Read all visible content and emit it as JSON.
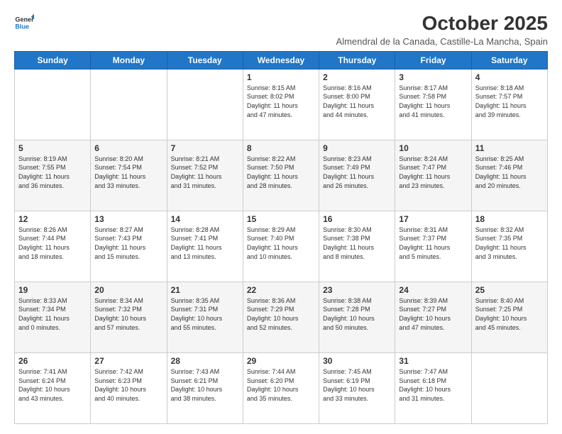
{
  "header": {
    "logo_line1": "General",
    "logo_line2": "Blue",
    "month": "October 2025",
    "location": "Almendral de la Canada, Castille-La Mancha, Spain"
  },
  "weekdays": [
    "Sunday",
    "Monday",
    "Tuesday",
    "Wednesday",
    "Thursday",
    "Friday",
    "Saturday"
  ],
  "weeks": [
    [
      {
        "day": "",
        "info": ""
      },
      {
        "day": "",
        "info": ""
      },
      {
        "day": "",
        "info": ""
      },
      {
        "day": "1",
        "info": "Sunrise: 8:15 AM\nSunset: 8:02 PM\nDaylight: 11 hours\nand 47 minutes."
      },
      {
        "day": "2",
        "info": "Sunrise: 8:16 AM\nSunset: 8:00 PM\nDaylight: 11 hours\nand 44 minutes."
      },
      {
        "day": "3",
        "info": "Sunrise: 8:17 AM\nSunset: 7:58 PM\nDaylight: 11 hours\nand 41 minutes."
      },
      {
        "day": "4",
        "info": "Sunrise: 8:18 AM\nSunset: 7:57 PM\nDaylight: 11 hours\nand 39 minutes."
      }
    ],
    [
      {
        "day": "5",
        "info": "Sunrise: 8:19 AM\nSunset: 7:55 PM\nDaylight: 11 hours\nand 36 minutes."
      },
      {
        "day": "6",
        "info": "Sunrise: 8:20 AM\nSunset: 7:54 PM\nDaylight: 11 hours\nand 33 minutes."
      },
      {
        "day": "7",
        "info": "Sunrise: 8:21 AM\nSunset: 7:52 PM\nDaylight: 11 hours\nand 31 minutes."
      },
      {
        "day": "8",
        "info": "Sunrise: 8:22 AM\nSunset: 7:50 PM\nDaylight: 11 hours\nand 28 minutes."
      },
      {
        "day": "9",
        "info": "Sunrise: 8:23 AM\nSunset: 7:49 PM\nDaylight: 11 hours\nand 26 minutes."
      },
      {
        "day": "10",
        "info": "Sunrise: 8:24 AM\nSunset: 7:47 PM\nDaylight: 11 hours\nand 23 minutes."
      },
      {
        "day": "11",
        "info": "Sunrise: 8:25 AM\nSunset: 7:46 PM\nDaylight: 11 hours\nand 20 minutes."
      }
    ],
    [
      {
        "day": "12",
        "info": "Sunrise: 8:26 AM\nSunset: 7:44 PM\nDaylight: 11 hours\nand 18 minutes."
      },
      {
        "day": "13",
        "info": "Sunrise: 8:27 AM\nSunset: 7:43 PM\nDaylight: 11 hours\nand 15 minutes."
      },
      {
        "day": "14",
        "info": "Sunrise: 8:28 AM\nSunset: 7:41 PM\nDaylight: 11 hours\nand 13 minutes."
      },
      {
        "day": "15",
        "info": "Sunrise: 8:29 AM\nSunset: 7:40 PM\nDaylight: 11 hours\nand 10 minutes."
      },
      {
        "day": "16",
        "info": "Sunrise: 8:30 AM\nSunset: 7:38 PM\nDaylight: 11 hours\nand 8 minutes."
      },
      {
        "day": "17",
        "info": "Sunrise: 8:31 AM\nSunset: 7:37 PM\nDaylight: 11 hours\nand 5 minutes."
      },
      {
        "day": "18",
        "info": "Sunrise: 8:32 AM\nSunset: 7:35 PM\nDaylight: 11 hours\nand 3 minutes."
      }
    ],
    [
      {
        "day": "19",
        "info": "Sunrise: 8:33 AM\nSunset: 7:34 PM\nDaylight: 11 hours\nand 0 minutes."
      },
      {
        "day": "20",
        "info": "Sunrise: 8:34 AM\nSunset: 7:32 PM\nDaylight: 10 hours\nand 57 minutes."
      },
      {
        "day": "21",
        "info": "Sunrise: 8:35 AM\nSunset: 7:31 PM\nDaylight: 10 hours\nand 55 minutes."
      },
      {
        "day": "22",
        "info": "Sunrise: 8:36 AM\nSunset: 7:29 PM\nDaylight: 10 hours\nand 52 minutes."
      },
      {
        "day": "23",
        "info": "Sunrise: 8:38 AM\nSunset: 7:28 PM\nDaylight: 10 hours\nand 50 minutes."
      },
      {
        "day": "24",
        "info": "Sunrise: 8:39 AM\nSunset: 7:27 PM\nDaylight: 10 hours\nand 47 minutes."
      },
      {
        "day": "25",
        "info": "Sunrise: 8:40 AM\nSunset: 7:25 PM\nDaylight: 10 hours\nand 45 minutes."
      }
    ],
    [
      {
        "day": "26",
        "info": "Sunrise: 7:41 AM\nSunset: 6:24 PM\nDaylight: 10 hours\nand 43 minutes."
      },
      {
        "day": "27",
        "info": "Sunrise: 7:42 AM\nSunset: 6:23 PM\nDaylight: 10 hours\nand 40 minutes."
      },
      {
        "day": "28",
        "info": "Sunrise: 7:43 AM\nSunset: 6:21 PM\nDaylight: 10 hours\nand 38 minutes."
      },
      {
        "day": "29",
        "info": "Sunrise: 7:44 AM\nSunset: 6:20 PM\nDaylight: 10 hours\nand 35 minutes."
      },
      {
        "day": "30",
        "info": "Sunrise: 7:45 AM\nSunset: 6:19 PM\nDaylight: 10 hours\nand 33 minutes."
      },
      {
        "day": "31",
        "info": "Sunrise: 7:47 AM\nSunset: 6:18 PM\nDaylight: 10 hours\nand 31 minutes."
      },
      {
        "day": "",
        "info": ""
      }
    ]
  ]
}
